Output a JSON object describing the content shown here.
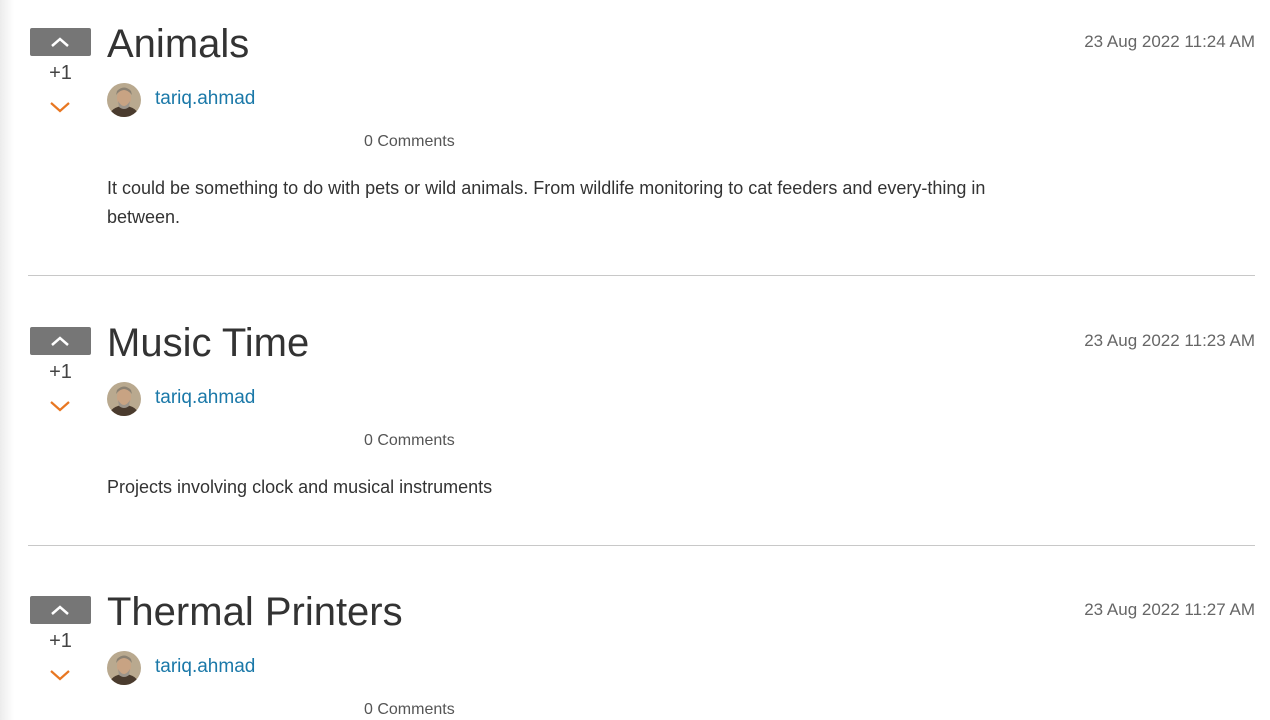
{
  "posts": [
    {
      "vote_count": "+1",
      "title": "Animals",
      "author": "tariq.ahmad",
      "date": "23 Aug 2022 11:24 AM",
      "comments": "0 Comments",
      "body": "It could be something to do with pets or wild animals. From wildlife monitoring to cat feeders and every-thing in between."
    },
    {
      "vote_count": "+1",
      "title": "Music Time",
      "author": "tariq.ahmad",
      "date": "23 Aug 2022 11:23 AM",
      "comments": "0 Comments",
      "body": "Projects involving clock and musical instruments"
    },
    {
      "vote_count": "+1",
      "title": "Thermal Printers",
      "author": "tariq.ahmad",
      "date": "23 Aug 2022 11:27 AM",
      "comments": "0 Comments",
      "body": ""
    }
  ],
  "icons": {
    "upvote": "chevron-up-icon",
    "downvote": "chevron-down-icon"
  },
  "colors": {
    "upvote_bg": "#767676",
    "downvote": "#e87722",
    "author_link": "#1a78a8"
  }
}
